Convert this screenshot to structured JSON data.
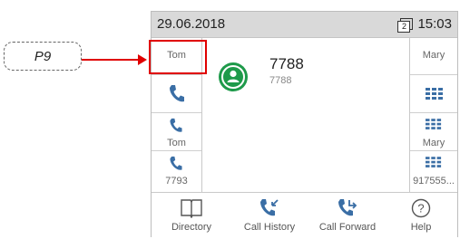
{
  "callout": {
    "label": "P9"
  },
  "statusbar": {
    "date": "29.06.2018",
    "line_badge": "2",
    "time": "15:03"
  },
  "left_keys": [
    {
      "label": "Tom",
      "icon": "none"
    },
    {
      "label": "",
      "icon": "handset-icon"
    },
    {
      "label": "Tom",
      "icon": "handset-icon"
    },
    {
      "label": "7793",
      "icon": "handset-icon"
    }
  ],
  "right_keys": [
    {
      "label": "Mary",
      "icon": "none"
    },
    {
      "label": "",
      "icon": "dialpad-icon"
    },
    {
      "label": "Mary",
      "icon": "dialpad-icon"
    },
    {
      "label": "917555...",
      "icon": "dialpad-icon"
    }
  ],
  "contact": {
    "name": "7788",
    "number": "7788",
    "avatar_color": "#1e9a4a"
  },
  "softkeys": [
    {
      "label": "Directory",
      "icon": "book-icon"
    },
    {
      "label": "Call History",
      "icon": "call-history-icon"
    },
    {
      "label": "Call Forward",
      "icon": "call-forward-icon"
    },
    {
      "label": "Help",
      "icon": "help-icon"
    }
  ],
  "colors": {
    "accent": "#1e9a4a",
    "highlight": "#e00000",
    "icon_blue": "#3a6ea5"
  }
}
